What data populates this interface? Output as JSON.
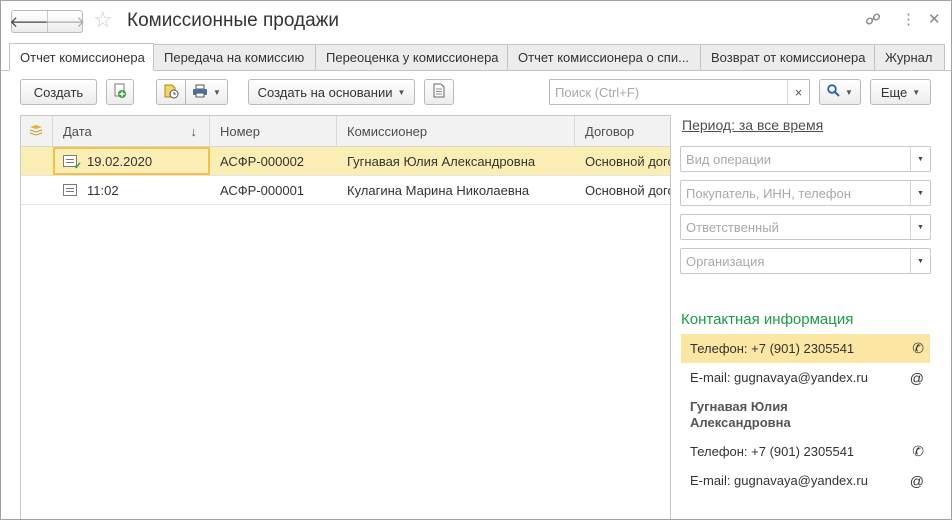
{
  "window": {
    "title": "Комиссионные продажи"
  },
  "tabs": [
    {
      "label": "Отчет комиссионера",
      "active": true
    },
    {
      "label": "Передача на комиссию",
      "active": false
    },
    {
      "label": "Переоценка у комиссионера",
      "active": false
    },
    {
      "label": "Отчет комиссионера о спи...",
      "active": false
    },
    {
      "label": "Возврат от комиссионера",
      "active": false
    },
    {
      "label": "Журнал",
      "active": false
    }
  ],
  "toolbar": {
    "create_label": "Создать",
    "create_based_label": "Создать на основании",
    "more_label": "Еще",
    "search_placeholder": "Поиск (Ctrl+F)",
    "clear_icon": "×"
  },
  "table": {
    "columns": [
      "Дата",
      "Номер",
      "Комиссионер",
      "Договор"
    ],
    "sort_indicator": "↓",
    "rows": [
      {
        "date": "19.02.2020",
        "number": "АСФР-000002",
        "agent": "Гугнавая Юлия Александровна",
        "contract": "Основной договор",
        "posted": true,
        "selected": true
      },
      {
        "date": "11:02",
        "number": "АСФР-000001",
        "agent": "Кулагина Марина Николаевна",
        "contract": "Основной договор",
        "posted": false,
        "selected": false
      }
    ]
  },
  "filters": {
    "period_label": "Период: за все время",
    "operation_placeholder": "Вид операции",
    "buyer_placeholder": "Покупатель, ИНН, телефон",
    "responsible_placeholder": "Ответственный",
    "organization_placeholder": "Организация"
  },
  "contacts": {
    "title": "Контактная информация",
    "org_phone": "Телефон: +7 (901) 2305541",
    "org_email": "E-mail: gugnavaya@yandex.ru",
    "person_name": "Гугнавая Юлия Александровна",
    "person_phone": "Телефон: +7 (901) 2305541",
    "person_email": "E-mail: gugnavaya@yandex.ru",
    "phone_icon": "✆",
    "email_icon": "@"
  },
  "colors": {
    "selection": "#fbeeb4",
    "contact_highlight": "#fbe7a3",
    "contacts_title": "#1b9a4a",
    "current_cell_border": "#f0c24a"
  }
}
